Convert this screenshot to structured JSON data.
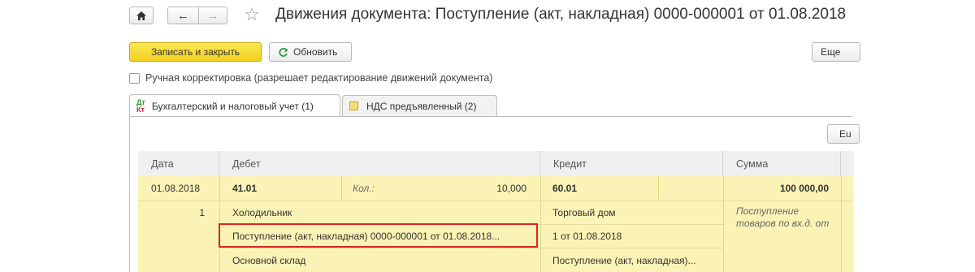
{
  "header": {
    "title": "Движения документа: Поступление (акт, накладная) 0000-000001 от 01.08.2018"
  },
  "toolbar": {
    "save_close_label": "Записать и закрыть",
    "refresh_label": "Обновить",
    "more_label": "Еще"
  },
  "manual_correction": {
    "label": "Ручная корректировка (разрешает редактирование движений документа)",
    "checked": false
  },
  "tabs": [
    {
      "label": "Бухгалтерский и налоговый учет (1)",
      "active": true
    },
    {
      "label": "НДС предъявленный (2)",
      "active": false
    }
  ],
  "grid_button_label": "Eu",
  "table": {
    "columns": [
      "Дата",
      "Дебет",
      "Кредит",
      "Сумма"
    ],
    "row": {
      "date": "01.08.2018",
      "line_no": "1",
      "debit_account": "41.01",
      "qty_label": "Кол.:",
      "qty_value": "10,000",
      "debit_sub1": "Холодильник",
      "debit_sub2": "Поступление (акт, накладная) 0000-000001 от 01.08.2018...",
      "debit_sub3": "Основной склад",
      "credit_account": "60.01",
      "credit_sub1": "Торговый дом",
      "credit_sub2": "1 от 01.08.2018",
      "credit_sub3": "Поступление (акт, накладная)...",
      "amount": "100 000,00",
      "content": "Поступление товаров по вх.д. от"
    }
  }
}
